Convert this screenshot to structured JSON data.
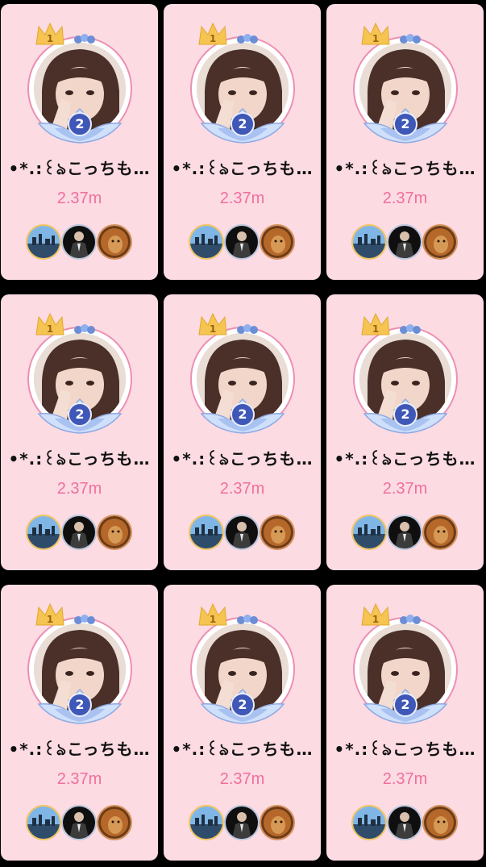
{
  "ranking_cards": [
    {
      "rank_crown": "1",
      "level": "2",
      "name": "•*.:꒰ঌこっちも…",
      "score": "2.37m"
    },
    {
      "rank_crown": "1",
      "level": "2",
      "name": "•*.:꒰ঌこっちも…",
      "score": "2.37m"
    },
    {
      "rank_crown": "1",
      "level": "2",
      "name": "•*.:꒰ঌこっちも…",
      "score": "2.37m"
    },
    {
      "rank_crown": "1",
      "level": "2",
      "name": "•*.:꒰ঌこっちも…",
      "score": "2.37m"
    },
    {
      "rank_crown": "1",
      "level": "2",
      "name": "•*.:꒰ঌこっちも…",
      "score": "2.37m"
    },
    {
      "rank_crown": "1",
      "level": "2",
      "name": "•*.:꒰ঌこっちも…",
      "score": "2.37m"
    },
    {
      "rank_crown": "1",
      "level": "2",
      "name": "•*.:꒰ঌこっちも…",
      "score": "2.37m"
    },
    {
      "rank_crown": "1",
      "level": "2",
      "name": "•*.:꒰ঌこっちも…",
      "score": "2.37m"
    },
    {
      "rank_crown": "1",
      "level": "2",
      "name": "•*.:꒰ঌこっちも…",
      "score": "2.37m"
    }
  ],
  "icons": {
    "crown": "crown-icon",
    "lotus": "lotus-frame-icon",
    "contributor_1": "city-skyline-avatar",
    "contributor_2": "man-in-suit-avatar",
    "contributor_3": "lion-avatar"
  },
  "colors": {
    "card_background": "#fcdbe3",
    "score_text": "#f06f9e",
    "level_badge": "#3f57b7",
    "crown": "#f5c451",
    "avatar_ring": "#ec8fb2",
    "grid_divider": "#000000"
  }
}
